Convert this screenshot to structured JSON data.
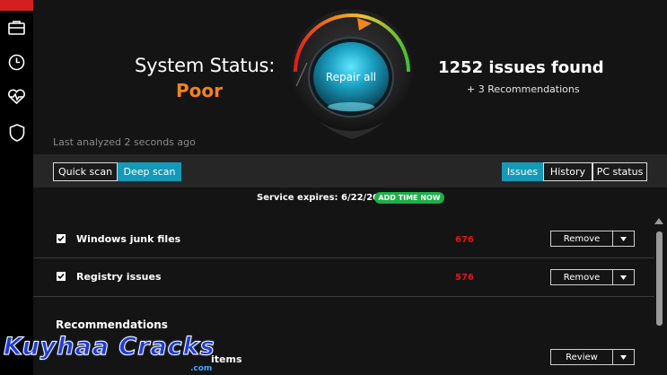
{
  "header": {
    "system_status_label": "System Status:",
    "system_status_value": "Poor",
    "last_analyzed": "Last analyzed 2 seconds ago",
    "issues_found": "1252 issues found",
    "recommendations_count": "+ 3 Recommendations",
    "repair_button_label": "Repair all"
  },
  "toolbar": {
    "quick_scan": "Quick scan",
    "deep_scan": "Deep scan",
    "tabs": [
      {
        "label": "Issues",
        "active": true
      },
      {
        "label": "History",
        "active": false
      },
      {
        "label": "PC status",
        "active": false
      }
    ]
  },
  "service": {
    "expires_text": "Service expires:  6/22/2020",
    "add_time_label": "ADD TIME NOW"
  },
  "issues": [
    {
      "label": "Windows junk files",
      "count": "676",
      "action": "Remove",
      "checked": true
    },
    {
      "label": "Registry issues",
      "count": "576",
      "action": "Remove",
      "checked": true
    }
  ],
  "recommendations": {
    "heading": "Recommendations",
    "items": [
      {
        "label": "items",
        "action": "Review"
      }
    ]
  },
  "watermark": {
    "text": "Kuyhaa Cracks",
    "sub": ".com"
  },
  "colors": {
    "accent": "#1599b8",
    "status_poor": "#f0831f",
    "issue_count": "#e0151c",
    "add_time": "#1fae48",
    "rail_top": "#d51f1f"
  },
  "sidebar": {
    "icons": [
      "briefcase-icon",
      "clock-icon",
      "heart-pulse-icon",
      "shield-icon"
    ]
  }
}
